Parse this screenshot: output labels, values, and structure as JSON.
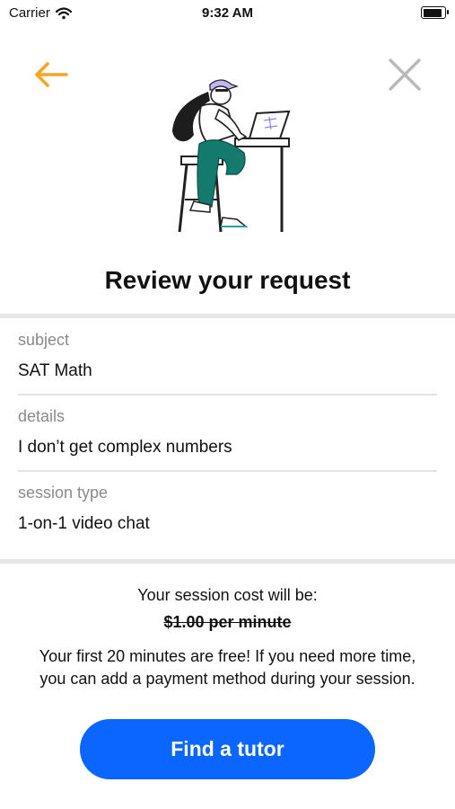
{
  "status_bar": {
    "carrier": "Carrier",
    "time": "9:32 AM"
  },
  "header": {
    "back_icon": "arrow-left-icon",
    "close_icon": "close-icon"
  },
  "title": "Review your request",
  "request": {
    "subject_label": "subject",
    "subject_value": "SAT Math",
    "details_label": "details",
    "details_value": "I don’t get complex numbers",
    "session_type_label": "session type",
    "session_type_value": "1-on-1 video chat"
  },
  "cost": {
    "heading": "Your session cost will be:",
    "price": "$1.00 per minute",
    "note": "Your first 20 minutes are free! If you need more time, you can add a payment method during your session."
  },
  "cta_label": "Find a tutor",
  "colors": {
    "accent_orange": "#f5a623",
    "primary_blue": "#0a66ff",
    "close_gray": "#b9b9b9"
  }
}
